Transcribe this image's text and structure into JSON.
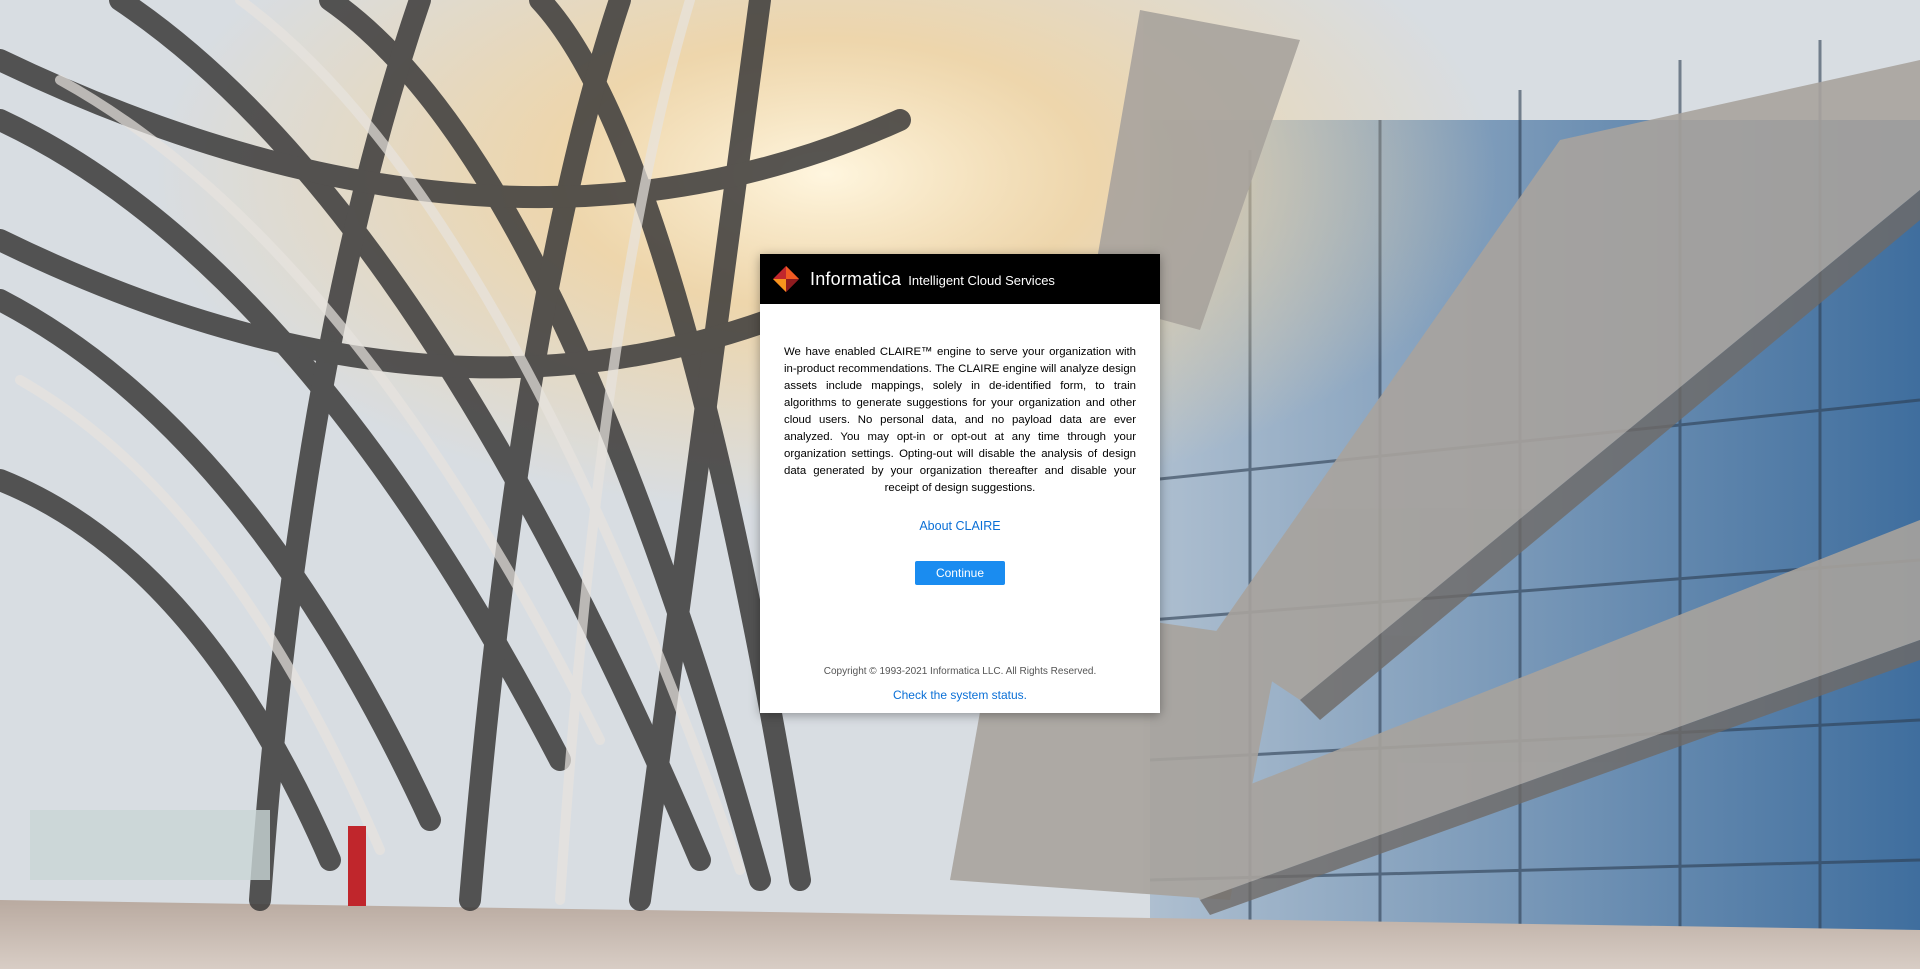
{
  "header": {
    "brand": "Informatica",
    "product": "Intelligent Cloud Services",
    "logo_icon": "informatica-logo-icon"
  },
  "dialog": {
    "message": "We have enabled CLAIRE™ engine to serve your organization with in-product recommendations. The CLAIRE engine will analyze design assets include mappings, solely in de-identified form, to train algorithms to generate suggestions for your organization and other cloud users. No personal data, and no payload data are ever analyzed. You may opt-in or opt-out at any time through your organization settings. Opting-out will disable the analysis of design data generated by your organization thereafter and disable your receipt of design suggestions.",
    "about_link": "About CLAIRE",
    "continue_label": "Continue"
  },
  "footer": {
    "copyright": "Copyright © 1993-2021 Informatica LLC. All Rights Reserved.",
    "status_link": "Check the system status."
  },
  "colors": {
    "header_bg": "#000000",
    "link": "#0a6fd6",
    "button": "#1a8cf0",
    "logo_orange": "#f15a22",
    "logo_red": "#c1272d"
  }
}
